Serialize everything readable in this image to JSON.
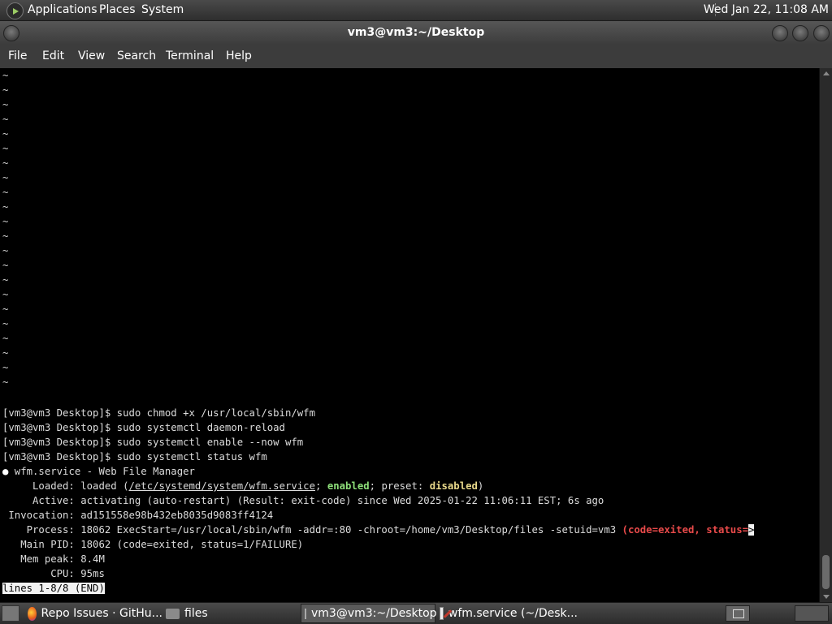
{
  "top_panel": {
    "menus": [
      "Applications",
      "Places",
      "System"
    ],
    "clock": "Wed Jan 22, 11:08 AM"
  },
  "window": {
    "title": "vm3@vm3:~/Desktop",
    "menubar": [
      "File",
      "Edit",
      "View",
      "Search",
      "Terminal",
      "Help"
    ]
  },
  "terminal": {
    "empty_line_marker": "~",
    "tilde_count": 22,
    "commands": [
      "[vm3@vm3 Desktop]$ sudo chmod +x /usr/local/sbin/wfm",
      "[vm3@vm3 Desktop]$ sudo systemctl daemon-reload",
      "[vm3@vm3 Desktop]$ sudo systemctl enable --now wfm",
      "[vm3@vm3 Desktop]$ sudo systemctl status wfm"
    ],
    "status": {
      "bullet": "●",
      "service_line": " wfm.service - Web File Manager",
      "loaded_prefix": "     Loaded: loaded (",
      "loaded_path": "/etc/systemd/system/wfm.service",
      "loaded_sep": "; ",
      "loaded_enabled": "enabled",
      "loaded_mid": "; preset: ",
      "loaded_disabled": "disabled",
      "loaded_end": ")",
      "active": "     Active: activating (auto-restart) (Result: exit-code) since Wed 2025-01-22 11:06:11 EST; 6s ago",
      "invocation": " Invocation: ad151558e98b432eb8035d9083ff4124",
      "process_prefix": "    Process: 18062 ExecStart=/usr/local/sbin/wfm -addr=:80 -chroot=/home/vm3/Desktop/files -setuid=vm3 ",
      "process_red": "(code=exited, status=",
      "process_cursor": ">",
      "main_pid": "   Main PID: 18062 (code=exited, status=1/FAILURE)",
      "mem_peak": "   Mem peak: 8.4M",
      "cpu": "        CPU: 95ms"
    },
    "pager_status": "lines 1-8/8 (END)"
  },
  "taskbar": {
    "tasks": [
      {
        "label": "Repo Issues · GitHu...",
        "icon": "firefox-icon"
      },
      {
        "label": "files",
        "icon": "folder-icon"
      },
      {
        "label": "vm3@vm3:~/Desktop",
        "icon": "terminal-icon",
        "active": true
      },
      {
        "label": "wfm.service (~/Desk...",
        "icon": "text-editor-icon"
      }
    ]
  },
  "colors": {
    "terminal_bg": "#000000",
    "terminal_fg": "#dcdcdc",
    "enabled_green": "#8ee07a",
    "disabled_yellow": "#e8d88a",
    "error_red": "#e84a4a"
  }
}
